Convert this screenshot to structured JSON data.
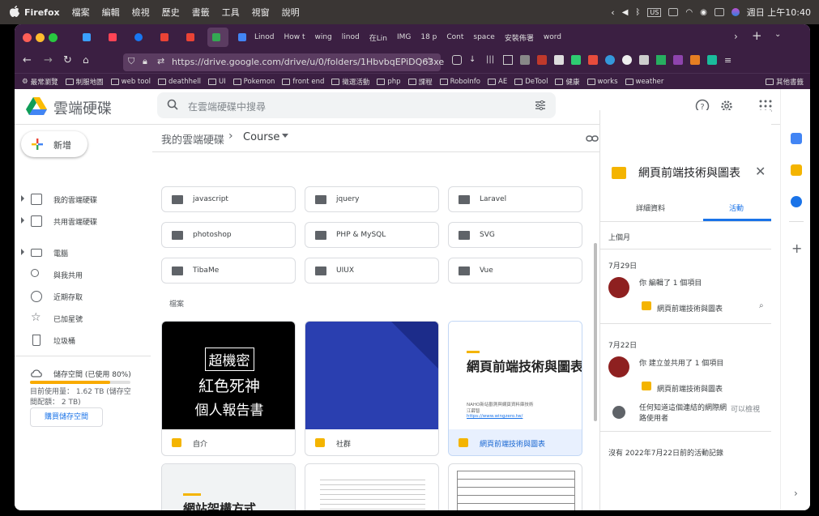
{
  "menubar": {
    "app": "Firefox",
    "items": [
      "檔案",
      "編輯",
      "檢視",
      "歷史",
      "書籤",
      "工具",
      "視窗",
      "說明"
    ],
    "clock": "週日 上午10:40",
    "input_method": "US"
  },
  "browser": {
    "tabs": [
      "Linod",
      "How t",
      "wing",
      "linod",
      "在Lin",
      "IMG",
      "18 p",
      "Cont",
      "space",
      "安裝佈署",
      "word"
    ],
    "url": "https://drive.google.com/drive/u/0/folders/1HbvbqEPiDQ63xe",
    "bookmarks": [
      "最常瀏覽",
      "制服地圖",
      "web tool",
      "deathhell",
      "UI",
      "Pokemon",
      "front end",
      "徵選活動",
      "php",
      "課程",
      "RoboInfo",
      "AE",
      "DeTool",
      "健康",
      "works",
      "weather"
    ],
    "other_bookmarks": "其他書籤"
  },
  "drive": {
    "product_name": "雲端硬碟",
    "search_placeholder": "在雲端硬碟中搜尋",
    "new_button": "新增",
    "nav": [
      {
        "label": "我的雲端硬碟",
        "icon": "my-drive-icon",
        "expandable": true
      },
      {
        "label": "共用雲端硬碟",
        "icon": "shared-drives-icon",
        "expandable": true
      },
      {
        "label": "電腦",
        "icon": "computer-icon",
        "expandable": true
      },
      {
        "label": "與我共用",
        "icon": "shared-with-me-icon",
        "expandable": false
      },
      {
        "label": "近期存取",
        "icon": "recent-icon",
        "expandable": false
      },
      {
        "label": "已加星號",
        "icon": "star-icon",
        "expandable": false
      },
      {
        "label": "垃圾桶",
        "icon": "trash-icon",
        "expandable": false
      }
    ],
    "storage": {
      "title": "儲存空間 (已使用 80%)",
      "usage": "目前使用量： 1.62 TB (儲存空間配額： 2 TB)",
      "used_percent": 80,
      "buy_button": "購買儲存空間"
    },
    "breadcrumb": {
      "root": "我的雲端硬碟",
      "current": "Course"
    },
    "folders": [
      "javascript",
      "jquery",
      "Laravel",
      "photoshop",
      "PHP & MySQL",
      "SVG",
      "TibaMe",
      "UIUX",
      "Vue"
    ],
    "files_label": "檔案",
    "files": [
      {
        "name": "自介",
        "thumb_lines": [
          "超機密",
          "紅色死神",
          "個人報告書"
        ]
      },
      {
        "name": "社群"
      },
      {
        "name": "網頁前端技術與圖表",
        "thumb_title": "網頁前端技術與圖表",
        "thumb_sub": [
          "NAHO新站觀測與網頁資料庫技術",
          "江薛智"
        ],
        "thumb_link": "https://www.wingzero.tw/"
      }
    ],
    "second_row": [
      {
        "thumb_title": "網站架構方式"
      }
    ]
  },
  "details": {
    "title": "網頁前端技術與圖表",
    "tabs": [
      "詳細資料",
      "活動"
    ],
    "active_tab": "活動",
    "period": "上個月",
    "entries": [
      {
        "date": "7月29日",
        "action": "你 編輯了 1 個項目",
        "file": "網頁前端技術與圖表"
      },
      {
        "date": "7月22日",
        "action": "你 建立並共用了 1 個項目",
        "file": "網頁前端技術與圖表",
        "note": "任何知道這個連結的網際網路使用者",
        "note_perm": "可以檢視"
      }
    ],
    "footer": "沒有 2022年7月22日前的活動記錄"
  },
  "colors": {
    "accent": "#1a73e8",
    "drive_yellow": "#f4b400",
    "browser_chrome": "#3b1f42"
  }
}
